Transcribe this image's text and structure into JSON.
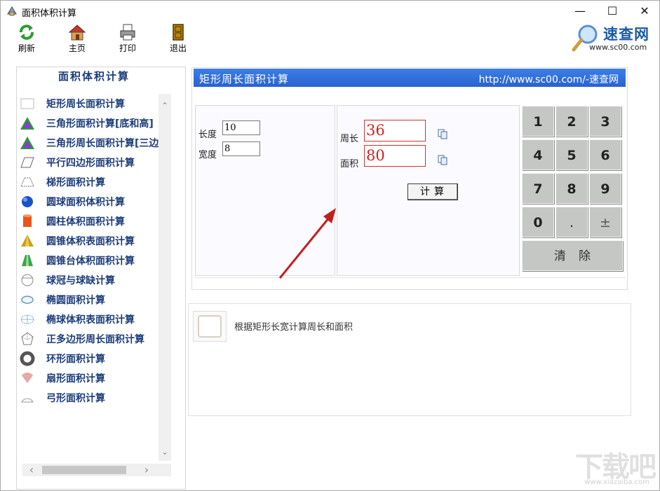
{
  "window": {
    "title": "面积体积计算",
    "minimize": "—",
    "maximize": "☐",
    "close": "✕"
  },
  "toolbar": {
    "items": [
      {
        "label": "刷新"
      },
      {
        "label": "主页"
      },
      {
        "label": "打印"
      },
      {
        "label": "退出"
      }
    ],
    "logo_text": "速查网",
    "logo_url": "www.sc00.com"
  },
  "sidebar": {
    "title": "面积体积计算",
    "items": [
      {
        "label": "矩形周长面积计算"
      },
      {
        "label": "三角形面积计算[底和高]"
      },
      {
        "label": "三角形周长面积计算[三边]"
      },
      {
        "label": "平行四边形面积计算"
      },
      {
        "label": "梯形面积计算"
      },
      {
        "label": "圆球面积体积计算"
      },
      {
        "label": "圆柱体积面积计算"
      },
      {
        "label": "圆锥体积表面积计算"
      },
      {
        "label": "圆锥台体积面积计算"
      },
      {
        "label": "球冠与球缺计算"
      },
      {
        "label": "椭圆面积计算"
      },
      {
        "label": "椭球体积表面积计算"
      },
      {
        "label": "正多边形周长面积计算"
      },
      {
        "label": "环形面积计算"
      },
      {
        "label": "扇形面积计算"
      },
      {
        "label": "弓形面积计算"
      }
    ],
    "scroll_up": "⌃",
    "scroll_down": "⌄",
    "scroll_left": "‹",
    "scroll_right": "›"
  },
  "calc": {
    "title": "矩形周长面积计算",
    "url": "http://www.sc00.com/-速查网",
    "length_label": "长度",
    "length_value": "10",
    "width_label": "宽度",
    "width_value": "8",
    "perimeter_label": "周长",
    "perimeter_value": "36",
    "area_label": "面积",
    "area_value": "80",
    "compute_label": "计算"
  },
  "keypad": {
    "keys": [
      "1",
      "2",
      "3",
      "4",
      "5",
      "6",
      "7",
      "8",
      "9",
      "0",
      ".",
      "±"
    ],
    "clear_label": "清除"
  },
  "description": {
    "text": "根据矩形长宽计算周长和面积"
  },
  "watermark": {
    "text": "下载吧",
    "url": "www.xiazaiba.com"
  }
}
